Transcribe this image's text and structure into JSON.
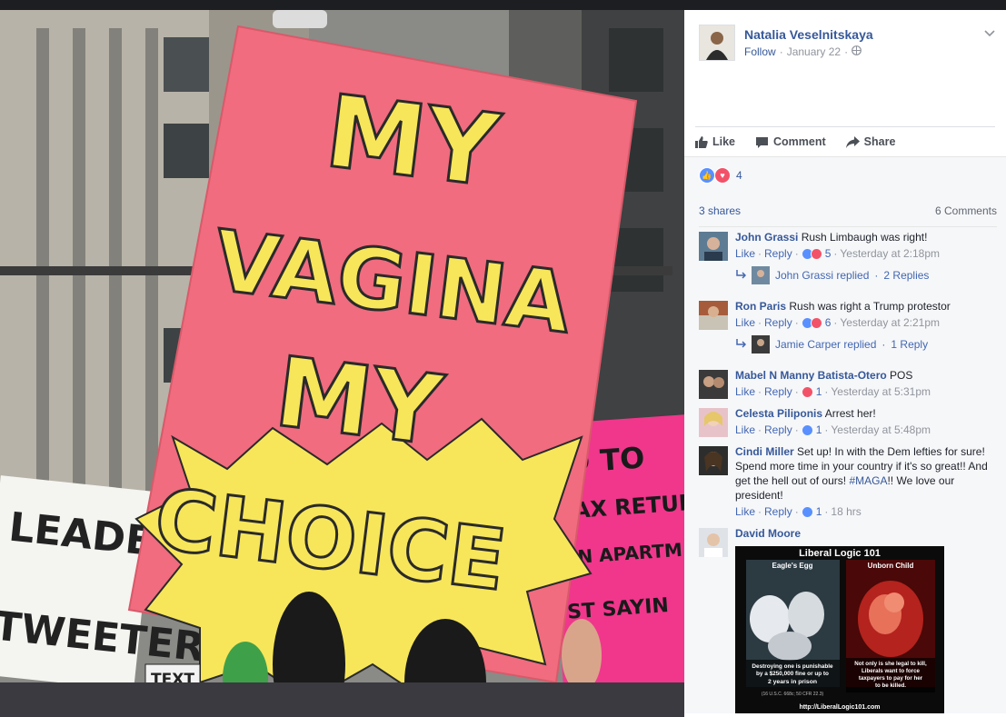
{
  "post": {
    "author": "Natalia Veselnitskaya",
    "follow": "Follow",
    "date": "January 22",
    "separator": "·"
  },
  "photo": {
    "sign_main": [
      "MY",
      "VAGINA",
      "MY",
      "CHOICE"
    ],
    "sign_left": [
      "LEADER",
      "TWEETER"
    ],
    "sign_right": [
      "D TO",
      "TAX RETUR",
      "AN APARTM",
      "ST SAYIN"
    ],
    "sign_small": "TEXT"
  },
  "actions": {
    "like": "Like",
    "comment": "Comment",
    "share": "Share"
  },
  "stats": {
    "reactions": "4",
    "shares": "3 shares",
    "comments": "6 Comments"
  },
  "comments": [
    {
      "name": "John Grassi",
      "text": "Rush Limbaugh was right!",
      "like": "Like",
      "reply": "Reply",
      "count": "5",
      "time": "Yesterday at 2:18pm",
      "replied_by": "John Grassi replied",
      "replies": "2 Replies"
    },
    {
      "name": "Ron Paris",
      "text": "Rush was right a Trump protestor",
      "like": "Like",
      "reply": "Reply",
      "count": "6",
      "time": "Yesterday at 2:21pm",
      "replied_by": "Jamie Carper replied",
      "replies": "1 Reply"
    },
    {
      "name": "Mabel N Manny Batista-Otero",
      "text": "POS",
      "like": "Like",
      "reply": "Reply",
      "count": "1",
      "time": "Yesterday at 5:31pm"
    },
    {
      "name": "Celesta Piliponis",
      "text": "Arrest her!",
      "like": "Like",
      "reply": "Reply",
      "count": "1",
      "time": "Yesterday at 5:48pm"
    },
    {
      "name": "Cindi Miller",
      "text": "Set up! In with the Dem lefties for sure! Spend more time in your country if it's so great!! And get the hell out of ours!",
      "hashtag": "#MAGA",
      "text_end": "!! We love our president!",
      "like": "Like",
      "reply": "Reply",
      "count": "1",
      "time": "18 hrs"
    },
    {
      "name": "David Moore"
    }
  ],
  "liberal_logic": {
    "title": "Liberal Logic 101",
    "left_label": "Eagle's Egg",
    "right_label": "Unborn Child",
    "left_caption": [
      "Destroying one is punishable",
      "by a $250,000 fine or up to",
      "2 years in prison"
    ],
    "left_law": "(16 U.S.C. 668c; 50 CFR 22.3)",
    "right_caption": [
      "Not only is she legal to kill,",
      "Liberals want to force",
      "taxpayers to pay for her",
      "to be killed."
    ],
    "url": "http://LiberalLogic101.com"
  },
  "icons": [
    "thumbs-up-icon",
    "comment-icon",
    "share-icon",
    "globe-icon",
    "chevron-down-icon",
    "reply-arrow-icon",
    "heart-icon"
  ],
  "colors": {
    "link": "#365899",
    "sign_pink": "#f06c7e",
    "sign_yellow": "#f7e65a",
    "like_blue": "#5890ff",
    "love_red": "#f25268"
  }
}
